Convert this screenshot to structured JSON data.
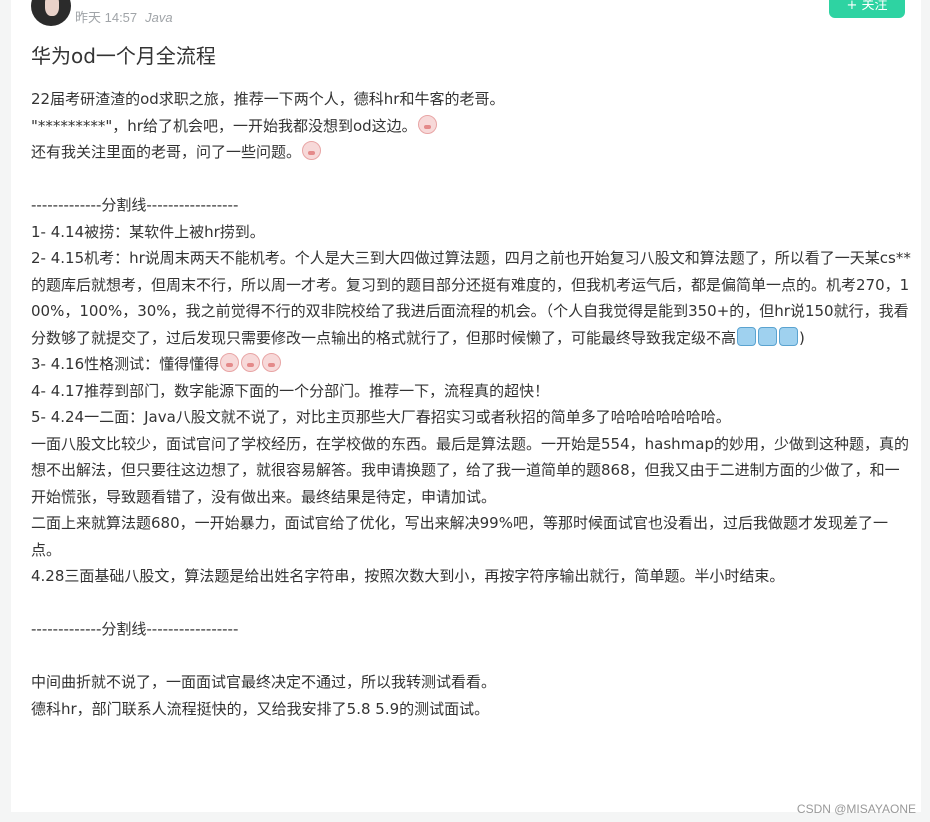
{
  "author": {
    "time": "昨天 14:57",
    "tag": "Java"
  },
  "follow_label": "+ 关注",
  "post": {
    "title": "华为od一个月全流程",
    "lines": [
      {
        "text": "22届考研渣渣的od求职之旅，推荐一下两个人，德科hr和牛客的老哥。"
      },
      {
        "text": "\"*********\"，hr给了机会吧，一开始我都没想到od这边。",
        "emoji": "smile-pig"
      },
      {
        "text": "还有我关注里面的老哥，问了一些问题。",
        "emoji": "smile-pig"
      },
      {
        "text": ""
      },
      {
        "text": "-------------分割线-----------------"
      },
      {
        "text": "1-   4.14被捞：某软件上被hr捞到。"
      },
      {
        "text": "2-   4.15机考：hr说周末两天不能机考。个人是大三到大四做过算法题，四月之前也开始复习八股文和算法题了，所以看了一天某cs**的题库后就想考，但周末不行，所以周一才考。复习到的题目部分还挺有难度的，但我机考运气后，都是偏简单一点的。机考270，100%，100%，30%，我之前觉得不行的双非院校给了我进后面流程的机会。（个人自我觉得是能到350+的，但hr说150就行，我看分数够了就提交了，过后发现只需要修改一点输出的格式就行了，但那时候懒了，可能最终导致我定级不高",
        "emoji_cry": 3,
        "suffix": ")"
      },
      {
        "text": "3-   4.16性格测试：懂得懂得",
        "emoji_count": 3
      },
      {
        "text": "4-   4.17推荐到部门，数字能源下面的一个分部门。推荐一下，流程真的超快！"
      },
      {
        "text": "5-   4.24一二面：Java八股文就不说了，对比主页那些大厂春招实习或者秋招的简单多了哈哈哈哈哈哈哈。"
      },
      {
        "text": "一面八股文比较少，面试官问了学校经历，在学校做的东西。最后是算法题。一开始是554，hashmap的妙用，少做到这种题，真的想不出解法，但只要往这边想了，就很容易解答。我申请换题了，给了我一道简单的题868，但我又由于二进制方面的少做了，和一开始慌张，导致题看错了，没有做出来。最终结果是待定，申请加试。"
      },
      {
        "text": "二面上来就算法题680，一开始暴力，面试官给了优化，写出来解决99%吧，等那时候面试官也没看出，过后我做题才发现差了一点。"
      },
      {
        "text": "4.28三面基础八股文，算法题是给出姓名字符串，按照次数大到小，再按字符序输出就行，简单题。半小时结束。"
      },
      {
        "text": ""
      },
      {
        "text": "-------------分割线-----------------"
      },
      {
        "text": ""
      },
      {
        "text": "中间曲折就不说了，一面面试官最终决定不通过，所以我转测试看看。"
      },
      {
        "text": "德科hr，部门联系人流程挺快的，又给我安排了5.8 5.9的测试面试。"
      }
    ]
  },
  "watermark": "CSDN @MISAYAONE"
}
